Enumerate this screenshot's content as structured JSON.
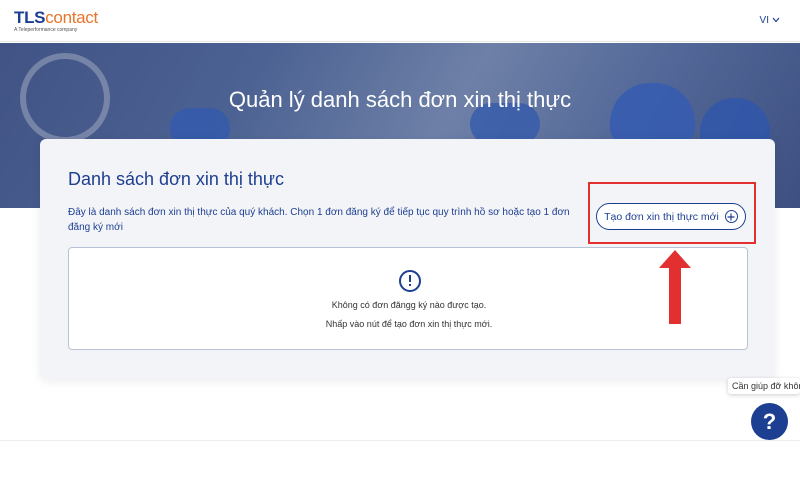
{
  "header": {
    "logo_tls": "TLS",
    "logo_contact": "contact",
    "logo_sub": "A Teleperformance company",
    "language": "VI"
  },
  "hero": {
    "title": "Quản lý danh sách đơn xin thị thực"
  },
  "card": {
    "title": "Danh sách đơn xin thị thực",
    "description": "Đây là danh sách đơn xin thị thực của quý khách. Chọn 1 đơn đăng ký để tiếp tục quy trình hồ sơ hoặc tạo 1 đơn đăng ký mới",
    "create_button_label": "Tạo đơn xin thị thực mới",
    "empty_state": {
      "line1": "Không có đơn đăngg ký nào được tạo.",
      "line2": "Nhấp vào nút để tạo đơn xin thị thực mới."
    }
  },
  "help": {
    "bubble_text": "Cần giúp đỡ không?",
    "button_label": "?"
  },
  "colors": {
    "brand_blue": "#1d3f91",
    "brand_orange": "#e8742b",
    "annotation_red": "#e23030"
  }
}
